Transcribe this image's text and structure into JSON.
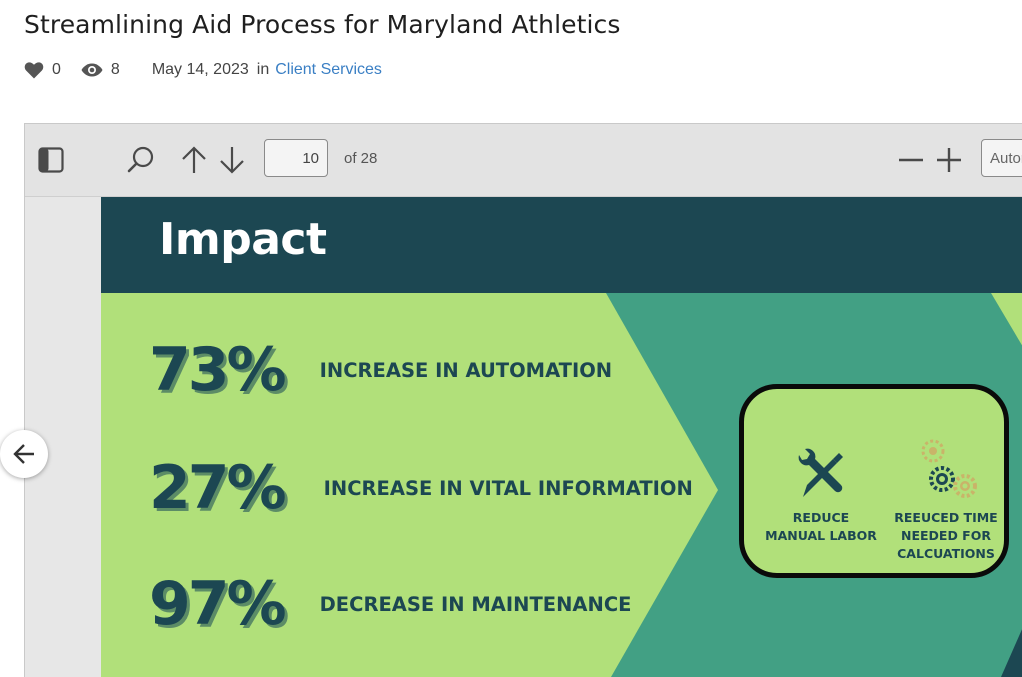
{
  "post": {
    "title": "Streamlining Aid Process for Maryland Athletics",
    "likes": "0",
    "views": "8",
    "date": "May 14, 2023",
    "in_label": "in",
    "category": "Client Services"
  },
  "viewer": {
    "toolbar": {
      "page_number": "10",
      "page_of": "of 28",
      "zoom_value": "Automatic Zoom"
    },
    "slide": {
      "heading": "Impact",
      "stats": [
        {
          "value": "73%",
          "label": "INCREASE IN AUTOMATION"
        },
        {
          "value": "27%",
          "label": "INCREASE IN VITAL INFORMATION"
        },
        {
          "value": "97%",
          "label": "DECREASE IN MAINTENANCE"
        }
      ],
      "benefits": [
        {
          "line1": "REDUCE",
          "line2": "MANUAL LABOR",
          "icon": "tools-icon"
        },
        {
          "line1": "REEUCED TIME",
          "line2": "NEEDED FOR",
          "line3": "CALCUATIONS",
          "icon": "gears-icon"
        }
      ],
      "colors": {
        "header": "#1c4752",
        "light_green": "#b1e07a",
        "teal": "#42a084",
        "gear_gold": "#c9b469"
      }
    }
  },
  "icons": {
    "like": "heart-icon",
    "views": "eye-icon",
    "sidebar": "sidebar-toggle-icon",
    "search": "search-icon",
    "prev": "arrow-up-icon",
    "next": "arrow-down-icon",
    "zoom_out": "minus-icon",
    "zoom_in": "plus-icon",
    "back": "arrow-left-icon"
  }
}
